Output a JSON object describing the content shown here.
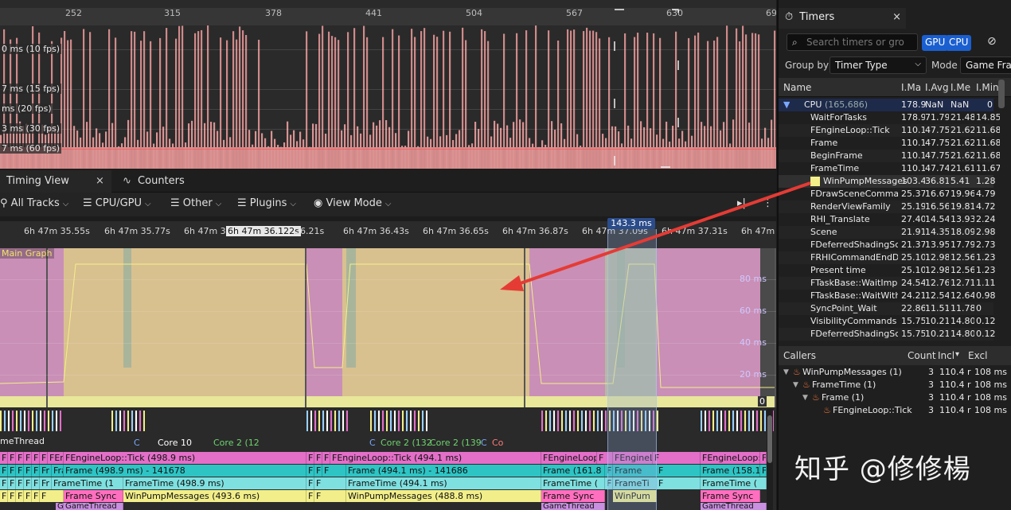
{
  "frames_panel": {
    "ticks": [
      "252",
      "315",
      "378",
      "441",
      "504",
      "567",
      "630",
      "69"
    ],
    "fps_labels": [
      "0 ms (10 fps)",
      "7 ms (15 fps)",
      "ms (20 fps)",
      "3 ms (30 fps)",
      "7 ms (60 fps)"
    ]
  },
  "timing_tabs": {
    "timing_view": "Timing View",
    "timing_view_close": "×",
    "counters": "Counters"
  },
  "toolbar": {
    "all_tracks": "All Tracks",
    "cpu_gpu": "CPU/GPU",
    "other": "Other",
    "plugins": "Plugins",
    "view_mode": "View Mode"
  },
  "time_ruler": {
    "labels": [
      "6h 47m 35.55s",
      "6h 47m 35.77s",
      "6h 47m 35",
      "6h 47m 36.122s",
      "36.21s",
      "6h 47m 36.43s",
      "6h 47m 36.65s",
      "6h 47m 36.87s",
      "6h 47m 37.09s",
      "6h 47m 37.31s",
      "6h 47m"
    ],
    "selection": "143.3 ms"
  },
  "graph": {
    "series_label": "Main Graph",
    "ms_labels": [
      "80 ms",
      "60 ms",
      "40 ms",
      "20 ms"
    ],
    "zero": "0"
  },
  "tracks": {
    "thread": "meThread",
    "core_labels": [
      "C",
      "Core 10",
      "Core 2 (12",
      "C",
      "Core 2 (132",
      "Core 2 (139",
      "C",
      "Co"
    ],
    "row1": [
      "F",
      "F",
      "F",
      "F",
      "F",
      "F",
      "FEngineLoop::",
      "FEngineLoop::Tick (498.9 ms)",
      "F",
      "F",
      "F",
      "FEngineLoop::Tick (494.1 ms)",
      "FEngineLoop:",
      "F",
      "FEngineL",
      "F",
      "FEngineLoop::",
      "F"
    ],
    "row2": [
      "F",
      "F",
      "F",
      "F",
      "F",
      "Fr",
      "Frame (162.6",
      "Frame (498.9 ms)  -  141678",
      "F",
      "F",
      "F",
      "Frame (494.1 ms)  -  141686",
      "Frame (161.8",
      "F",
      "Frame",
      "F",
      "Frame (158.1",
      "F"
    ],
    "row3": [
      "F",
      "F",
      "F",
      "F",
      "F",
      "Fr",
      "FrameTime (1",
      "FrameTime (498.9 ms)",
      "F",
      "F",
      "FrameTime (494.1 ms)",
      "FrameTime (",
      "F",
      "FrameTi",
      "F",
      "FrameTime (",
      "F"
    ],
    "row4": [
      "F",
      "F",
      "F",
      "F",
      "F",
      "F",
      "Frame Sync",
      "WinPumpMessages (493.6 ms)",
      "F",
      "F",
      "WinPumpMessages (488.8 ms)",
      "Frame Sync",
      "WinPum",
      "Frame Sync"
    ],
    "row5": [
      "G",
      "GameThread",
      "GameThread",
      "GameThread"
    ]
  },
  "timers": {
    "tab_title": "Timers",
    "tab_close": "×",
    "search_placeholder": "Search timers or gro",
    "gpu": "GPU",
    "cpu": "CPU",
    "group_by_label": "Group by",
    "group_by_value": "Timer Type",
    "mode_label": "Mode",
    "mode_value": "Game Fra",
    "columns": [
      "Name",
      "I.Ma",
      "I.Avg",
      "I.Me",
      "I.Min"
    ],
    "root": {
      "name": "CPU",
      "count": "(165,686)",
      "max": "178.9",
      "avg": "NaN",
      "med": "NaN",
      "min": "0"
    },
    "rows": [
      {
        "name": "WaitForTasks",
        "max": "178.9",
        "avg": "71.79",
        "med": "21.48",
        "min": "14.85"
      },
      {
        "name": "FEngineLoop::Tick",
        "max": "110.1",
        "avg": "47.75",
        "med": "21.62",
        "min": "11.68"
      },
      {
        "name": "Frame",
        "max": "110.1",
        "avg": "47.75",
        "med": "21.62",
        "min": "11.68"
      },
      {
        "name": "BeginFrame",
        "max": "110.1",
        "avg": "47.75",
        "med": "21.62",
        "min": "11.68"
      },
      {
        "name": "FrameTime",
        "max": "110.1",
        "avg": "47.74",
        "med": "21.61",
        "min": "11.67"
      },
      {
        "name": "WinPumpMessages",
        "max": "103.4",
        "avg": "36.81",
        "med": "5.41",
        "min": "1.28"
      },
      {
        "name": "FDrawSceneCommand",
        "max": "25.37",
        "avg": "16.67",
        "med": "19.96",
        "min": "4.79"
      },
      {
        "name": "RenderViewFamily",
        "max": "25.19",
        "avg": "16.56",
        "med": "19.81",
        "min": "4.72"
      },
      {
        "name": "RHI_Translate",
        "max": "27.40",
        "avg": "14.54",
        "med": "13.93",
        "min": "2.24"
      },
      {
        "name": "Scene",
        "max": "21.91",
        "avg": "14.35",
        "med": "18.09",
        "min": "2.98"
      },
      {
        "name": "FDeferredShadingSce",
        "max": "21.37",
        "avg": "13.95",
        "med": "17.79",
        "min": "2.73"
      },
      {
        "name": "FRHICommandEndDra",
        "max": "25.10",
        "avg": "12.98",
        "med": "12.56",
        "min": "1.23"
      },
      {
        "name": "Present time",
        "max": "25.10",
        "avg": "12.98",
        "med": "12.56",
        "min": "1.23"
      },
      {
        "name": "FTaskBase::WaitImpl_",
        "max": "24.54",
        "avg": "12.76",
        "med": "12.71",
        "min": "1.11"
      },
      {
        "name": "FTaskBase::WaitWith",
        "max": "24.21",
        "avg": "12.54",
        "med": "12.64",
        "min": "0.98"
      },
      {
        "name": "SyncPoint_Wait",
        "max": "22.86",
        "avg": "11.51",
        "med": "11.78",
        "min": "0"
      },
      {
        "name": "VisibilityCommands",
        "max": "15.75",
        "avg": "10.21",
        "med": "14.80",
        "min": "0.12"
      },
      {
        "name": "FDeferredShadingSce",
        "max": "15.75",
        "avg": "10.21",
        "med": "14.80",
        "min": "0.12"
      }
    ],
    "callers": {
      "columns": [
        "Callers",
        "Count",
        "Incl",
        "Excl"
      ],
      "rows": [
        {
          "name": "WinPumpMessages",
          "count_paren": "(1)",
          "count": "3",
          "incl": "110.4 r",
          "excl": "108 ms"
        },
        {
          "name": "FrameTime",
          "count_paren": "(1)",
          "count": "3",
          "incl": "110.4 r",
          "excl": "108 ms"
        },
        {
          "name": "Frame",
          "count_paren": "(1)",
          "count": "3",
          "incl": "110.4 r",
          "excl": "108 ms"
        },
        {
          "name": "FEngineLoop::Tick",
          "count_paren": "",
          "count": "3",
          "incl": "110.4 r",
          "excl": "108 ms"
        }
      ]
    }
  },
  "watermark": "知乎 @修修楊",
  "colors": {
    "accent_blue": "#1a5fd0",
    "frame_pink": "#d98b8b",
    "tick_pink": "#e36fc8",
    "frame_cyan": "#2ec4c4",
    "frametime_teal": "#7fe0e0",
    "winpump_yellow": "#f2ef8a",
    "arrow_red": "#e53b35"
  }
}
